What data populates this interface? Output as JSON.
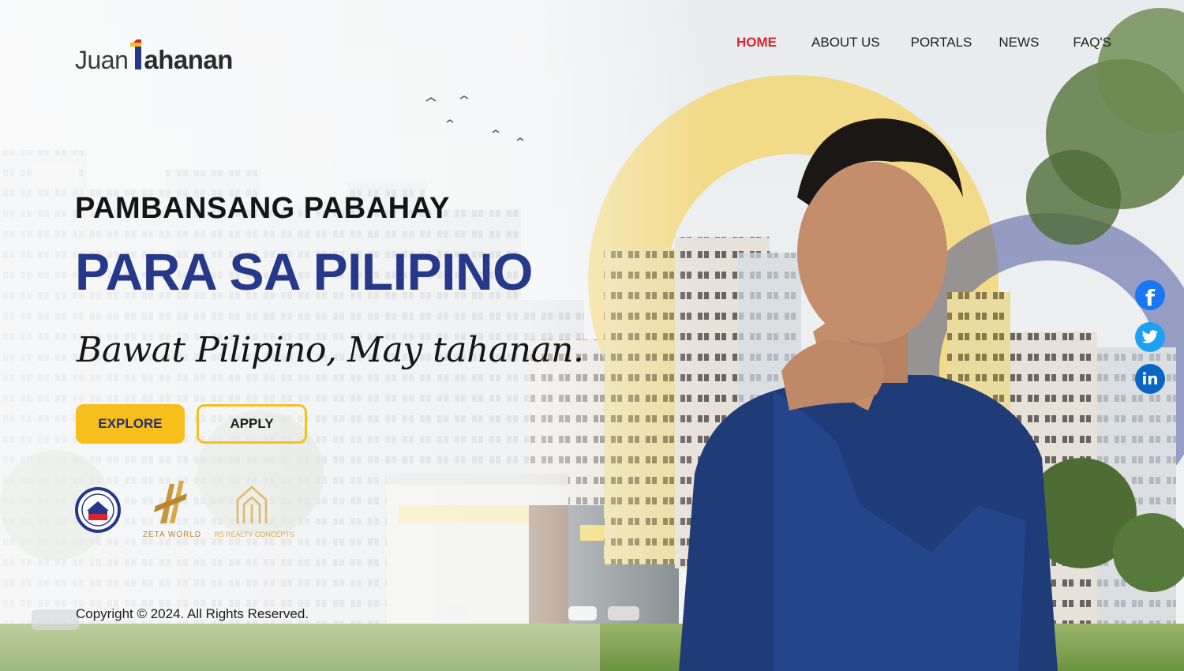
{
  "brand": {
    "logo_light": "Juan",
    "logo_bold": "ahanan"
  },
  "nav": {
    "items": [
      {
        "label": "HOME",
        "active": true
      },
      {
        "label": "ABOUT US",
        "active": false
      },
      {
        "label": "PORTALS",
        "active": false
      },
      {
        "label": "NEWS",
        "active": false
      },
      {
        "label": "FAQ'S",
        "active": false
      }
    ]
  },
  "hero": {
    "kicker": "PAMBANSANG PABAHAY",
    "headline": "PARA SA PILIPINO",
    "tagline": "Bawat Pilipino, May tahanan."
  },
  "buttons": {
    "explore": "EXPLORE",
    "apply": "APPLY"
  },
  "partners": {
    "zeta_name": "ZETA WORLD",
    "rs_name": "RS REALTY CONCEPTS"
  },
  "footer": {
    "copyright": "Copyright © 2024. All Rights Reserved."
  },
  "social": {
    "facebook_glyph": "f",
    "twitter_glyph": "t",
    "linkedin_glyph": "in"
  },
  "colors": {
    "accent_yellow": "#f6bf1c",
    "headline_blue": "#26388a",
    "nav_active_red": "#d8252e",
    "facebook_blue": "#1877f2",
    "twitter_blue": "#1da1f2",
    "linkedin_blue": "#0a66c2"
  }
}
